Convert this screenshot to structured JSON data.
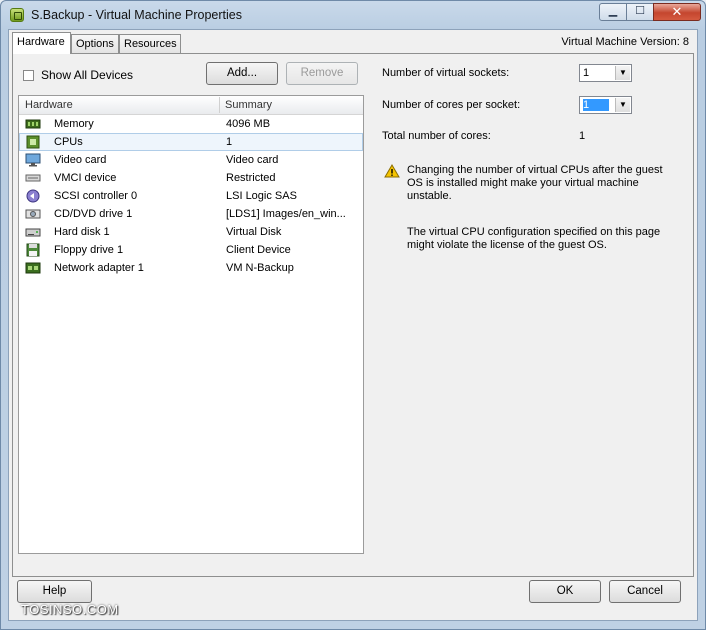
{
  "window": {
    "title": "S.Backup - Virtual Machine Properties",
    "controls": {
      "minimize": "▁",
      "maximize": "☐",
      "close": "✕"
    }
  },
  "tabs": [
    {
      "label": "Hardware",
      "active": true
    },
    {
      "label": "Options",
      "active": false
    },
    {
      "label": "Resources",
      "active": false
    }
  ],
  "vm_version": "Virtual Machine Version: 8",
  "show_all_devices": {
    "label": "Show All Devices",
    "checked": false
  },
  "buttons": {
    "add": "Add...",
    "remove": "Remove",
    "help": "Help",
    "ok": "OK",
    "cancel": "Cancel"
  },
  "hardware_list": {
    "columns": [
      "Hardware",
      "Summary"
    ],
    "rows": [
      {
        "icon": "memory-icon",
        "name": "Memory",
        "summary": "4096 MB"
      },
      {
        "icon": "cpu-icon",
        "name": "CPUs",
        "summary": "1",
        "selected": true
      },
      {
        "icon": "monitor-icon",
        "name": "Video card",
        "summary": "Video card"
      },
      {
        "icon": "vmci-icon",
        "name": "VMCI device",
        "summary": "Restricted"
      },
      {
        "icon": "scsi-icon",
        "name": "SCSI controller 0",
        "summary": "LSI Logic SAS"
      },
      {
        "icon": "cd-dvd-icon",
        "name": "CD/DVD drive 1",
        "summary": "[LDS1] Images/en_win..."
      },
      {
        "icon": "hard-disk-icon",
        "name": "Hard disk 1",
        "summary": "Virtual Disk"
      },
      {
        "icon": "floppy-icon",
        "name": "Floppy drive 1",
        "summary": "Client Device"
      },
      {
        "icon": "network-adapter-icon",
        "name": "Network adapter 1",
        "summary": "VM N-Backup"
      }
    ]
  },
  "cpu_settings": {
    "sockets_label": "Number of virtual sockets:",
    "sockets_value": "1",
    "cores_label": "Number of cores per socket:",
    "cores_value": "1",
    "total_label": "Total number of cores:",
    "total_value": "1",
    "warning_icon": "warning-icon",
    "warning_text": "Changing the number of virtual CPUs after the guest OS is installed might make your virtual machine unstable.",
    "license_text": "The virtual CPU configuration specified on this page might violate the license of the guest OS."
  },
  "watermark": "TOSINSO.COM",
  "colors": {
    "selection": "#3399ff",
    "row_selected": "#eef5fc",
    "warning": "#f5c400"
  }
}
